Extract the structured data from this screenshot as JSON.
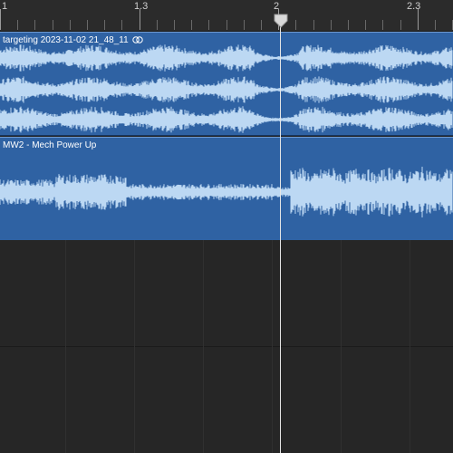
{
  "ruler": {
    "labels": [
      "1",
      "1.3",
      "2",
      "2.3"
    ]
  },
  "tracks": [
    {
      "region_name": "targeting 2023-11-02 21_48_11",
      "looped": true,
      "icon": "loop-icon"
    },
    {
      "region_name": "MW2 - Mech Power Up",
      "looped": false
    }
  ],
  "colors": {
    "region_fill": "#2f62a3",
    "waveform": "#bcd8f3",
    "background": "#262626",
    "playhead": "#e6e6e6"
  }
}
